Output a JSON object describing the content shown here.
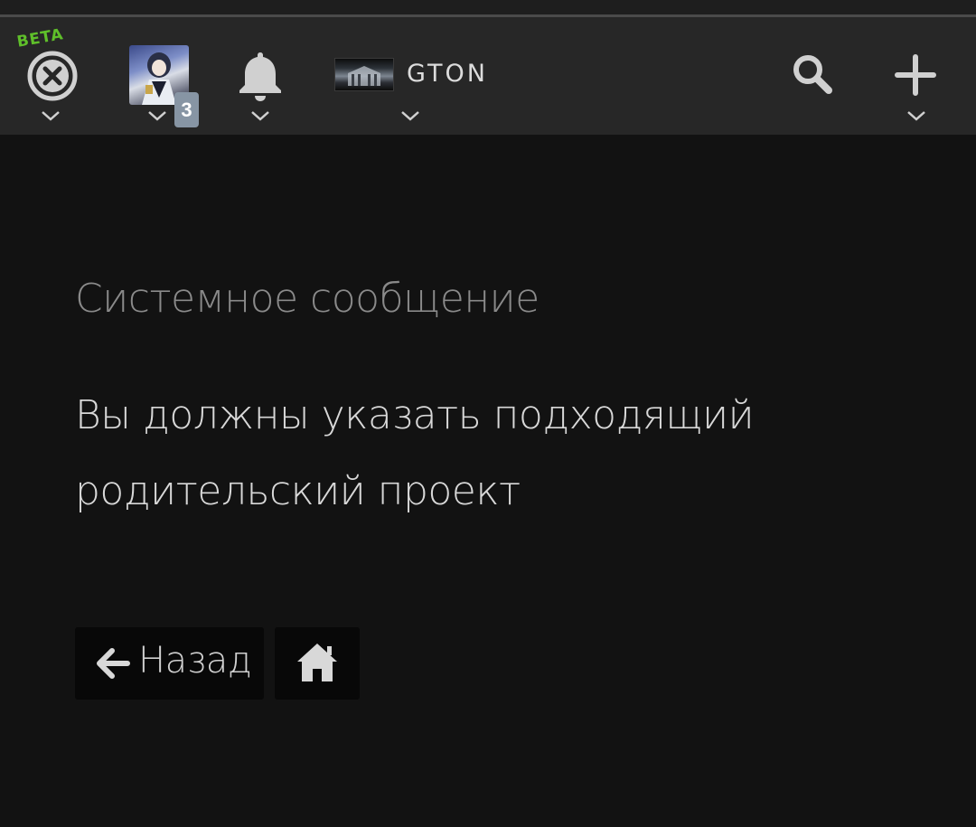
{
  "navbar": {
    "logo": {
      "beta_label": "BETA",
      "icon": "x-circle-icon"
    },
    "avatar": {
      "notification_count": "3"
    },
    "bell": {
      "icon": "bell-icon"
    },
    "project": {
      "name": "GTON"
    },
    "search": {
      "icon": "search-icon"
    },
    "add": {
      "icon": "plus-icon"
    }
  },
  "message": {
    "title": "Системное сообщение",
    "body": "Вы должны указать подходящий родительский проект"
  },
  "actions": {
    "back_label": "Назад",
    "back_icon": "arrow-left-icon",
    "home_icon": "home-icon"
  },
  "colors": {
    "background": "#121212",
    "navbar": "#272727",
    "beta": "#5fbf2a",
    "badge": "#8795a4"
  }
}
